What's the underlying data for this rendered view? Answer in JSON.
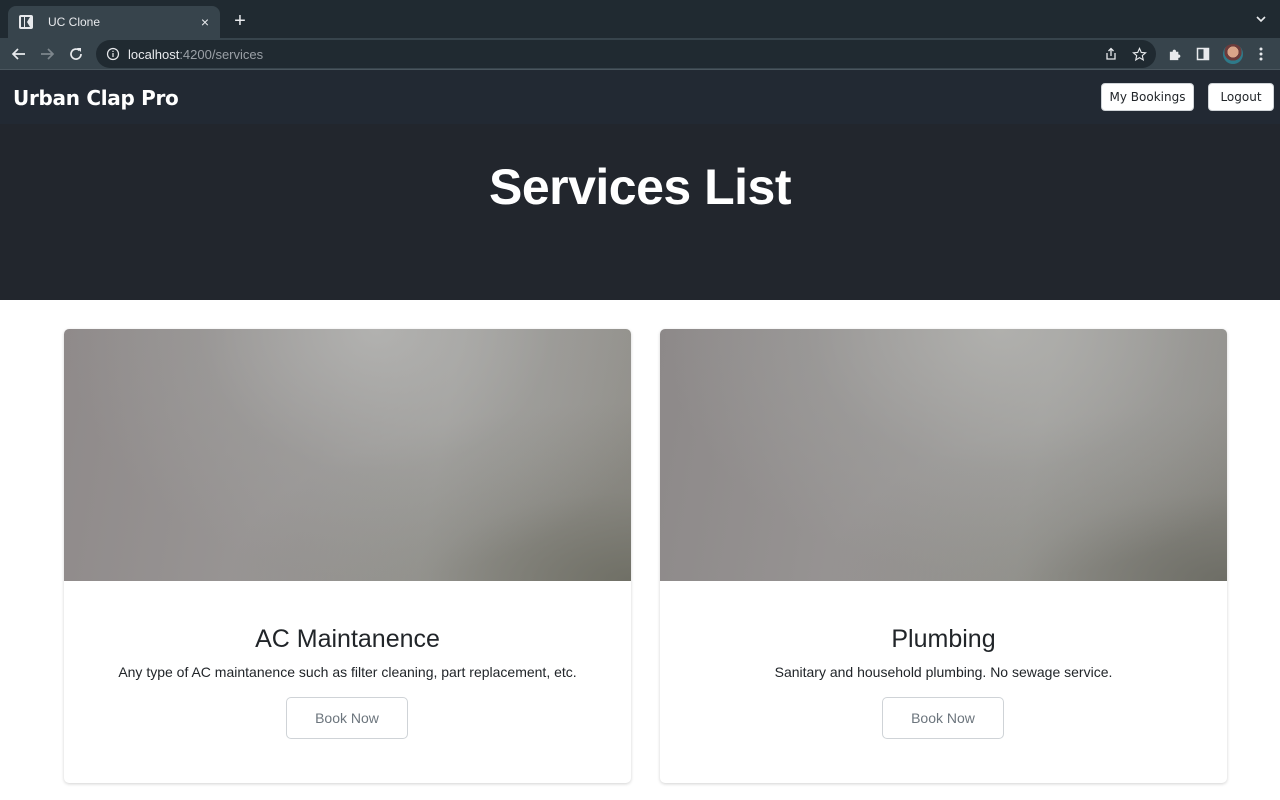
{
  "browser": {
    "tab_title": "UC Clone",
    "tab_close": "×",
    "new_tab": "+",
    "url_host": "localhost",
    "url_path": ":4200/services"
  },
  "navbar": {
    "brand": "Urban Clap Pro",
    "my_bookings": "My Bookings",
    "logout": "Logout"
  },
  "hero": {
    "title": "Services List"
  },
  "services": [
    {
      "title": "AC Maintanence",
      "description": "Any type of AC maintanence such as filter cleaning, part replacement, etc.",
      "button": "Book Now"
    },
    {
      "title": "Plumbing",
      "description": "Sanitary and household plumbing. No sewage service.",
      "button": "Book Now"
    }
  ],
  "colors": {
    "navbar_bg": "#222933",
    "hero_bg": "#22262d",
    "tab_bg": "#37444c",
    "tabstrip_bg": "#202a31"
  }
}
